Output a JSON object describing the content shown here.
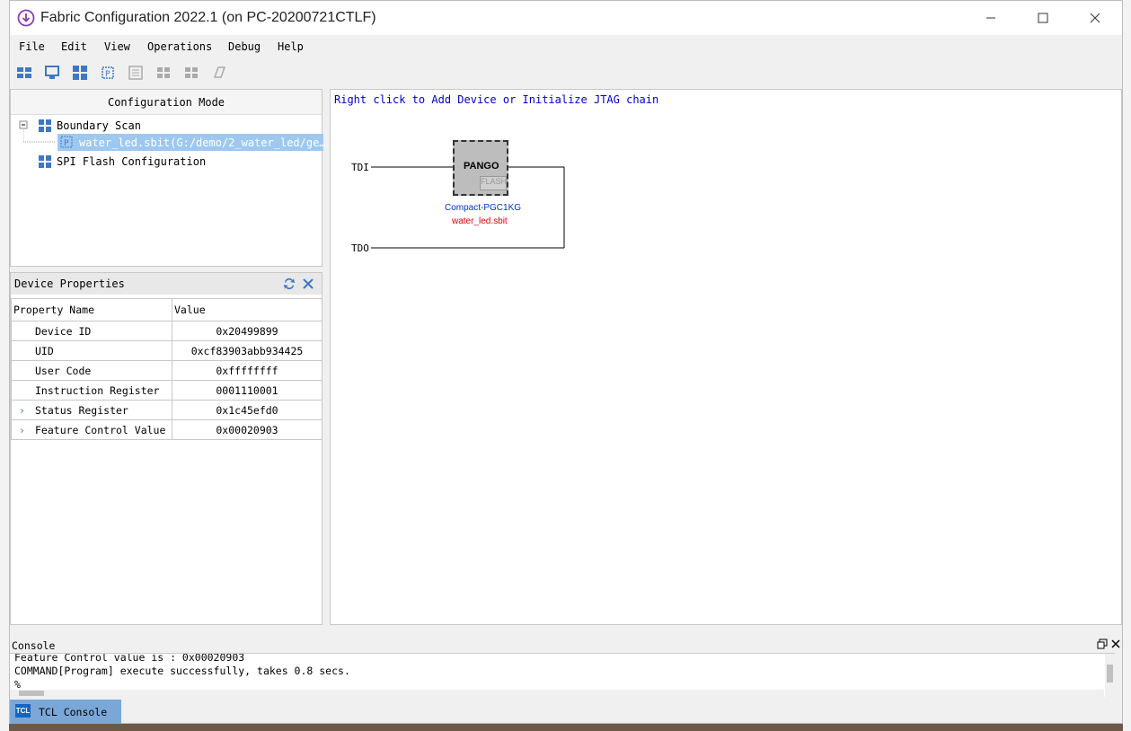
{
  "window": {
    "title": "Fabric Configuration 2022.1 (on PC-20200721CTLF)",
    "accent": "#8a3db5"
  },
  "menu": [
    "File",
    "Edit",
    "View",
    "Operations",
    "Debug",
    "Help"
  ],
  "toolbar_icons": [
    "scan-chain-icon",
    "monitor-icon",
    "grid-icon",
    "chip-icon",
    "list-icon",
    "connect-icon",
    "disconnect-icon",
    "erase-icon"
  ],
  "config_panel": {
    "header": "Configuration Mode",
    "tree": {
      "boundary_scan": "Boundary Scan",
      "file_entry": "water_led.sbit(G:/demo/2_water_led/ge…",
      "spi_flash": "SPI Flash Configuration"
    }
  },
  "properties_panel": {
    "header": "Device Properties",
    "columns": [
      "Property Name",
      "Value"
    ],
    "rows": [
      {
        "name": "Device ID",
        "value": "0x20499899",
        "expandable": false
      },
      {
        "name": "UID",
        "value": "0xcf83903abb934425",
        "expandable": false
      },
      {
        "name": "User Code",
        "value": "0xffffffff",
        "expandable": false
      },
      {
        "name": "Instruction Register",
        "value": "0001110001",
        "expandable": false
      },
      {
        "name": "Status Register",
        "value": "0x1c45efd0",
        "expandable": true
      },
      {
        "name": "Feature Control Value",
        "value": "0x00020903",
        "expandable": true
      }
    ]
  },
  "canvas": {
    "hint": "Right click to Add Device or Initialize JTAG chain",
    "tdi_label": "TDI",
    "tdo_label": "TDO",
    "chip_vendor": "PANGO",
    "chip_flash": "FLASH",
    "device_name": "Compact-PGC1KG",
    "file_name": "water_led.sbit"
  },
  "console": {
    "header": "Console",
    "lines": [
      "Feature Control value is : 0x00020903",
      "COMMAND[Program] execute successfully, takes 0.8 secs.",
      "%"
    ],
    "tab_label": "TCL Console",
    "tab_badge": "TCL"
  }
}
